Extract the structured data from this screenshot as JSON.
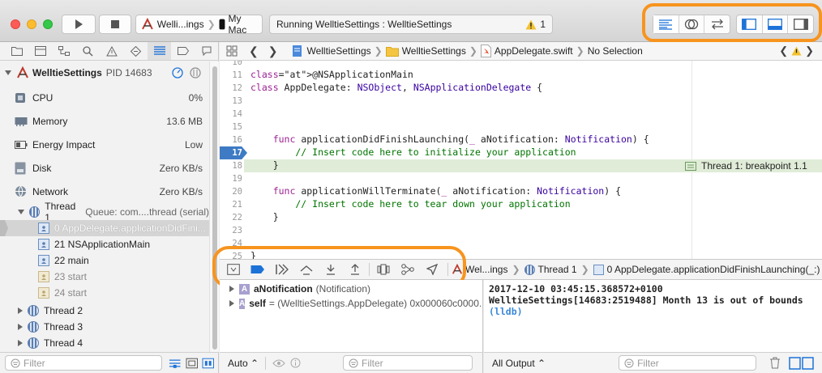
{
  "colors": {
    "accent": "#1d72d8",
    "highlight": "#f7941e",
    "breakpoint_line": "#e0ecd8",
    "breakpoint": "#3e7bc4"
  },
  "toolbar": {
    "scheme_target": "Welli...ings",
    "device": "My Mac",
    "status": "Running WelltieSettings : WelltieSettings",
    "warning_count": "1",
    "editor_icons": [
      "standard-editor-icon",
      "assistant-editor-icon",
      "version-editor-icon"
    ],
    "view_icons": [
      "navigator-toggle-icon",
      "debug-area-toggle-icon",
      "utilities-toggle-icon"
    ]
  },
  "navigator": {
    "process": {
      "name": "WelltieSettings",
      "pid": "PID 14683"
    },
    "gauges": [
      {
        "label": "CPU",
        "value": "0%",
        "icon": "cpu-icon"
      },
      {
        "label": "Memory",
        "value": "13.6 MB",
        "icon": "memory-icon"
      },
      {
        "label": "Energy Impact",
        "value": "Low",
        "icon": "energy-icon"
      },
      {
        "label": "Disk",
        "value": "Zero KB/s",
        "icon": "disk-icon"
      },
      {
        "label": "Network",
        "value": "Zero KB/s",
        "icon": "network-icon"
      }
    ],
    "thread1": {
      "name": "Thread 1",
      "queue": "Queue: com....thread (serial)"
    },
    "frames": [
      {
        "label": "0 AppDelegate.applicationDidFini...",
        "selected": true,
        "dim": false
      },
      {
        "label": "21 NSApplicationMain",
        "selected": false,
        "dim": false
      },
      {
        "label": "22 main",
        "selected": false,
        "dim": false
      },
      {
        "label": "23 start",
        "selected": false,
        "dim": true
      },
      {
        "label": "24 start",
        "selected": false,
        "dim": true
      }
    ],
    "threads": [
      "Thread 2",
      "Thread 3",
      "Thread 4"
    ],
    "filter_placeholder": "Filter"
  },
  "jumpbar": {
    "project": "WelltieSettings",
    "group": "WelltieSettings",
    "file": "AppDelegate.swift",
    "selection": "No Selection"
  },
  "editor": {
    "lines": [
      {
        "n": "10",
        "text": ""
      },
      {
        "n": "11",
        "text": "@NSApplicationMain"
      },
      {
        "n": "12",
        "text": "class AppDelegate: NSObject, NSApplicationDelegate {"
      },
      {
        "n": "13",
        "text": ""
      },
      {
        "n": "14",
        "text": ""
      },
      {
        "n": "15",
        "text": ""
      },
      {
        "n": "16",
        "text": "    func applicationDidFinishLaunching(_ aNotification: Notification) {"
      },
      {
        "n": "17",
        "text": "        // Insert code here to initialize your application"
      },
      {
        "n": "18",
        "text": "    }"
      },
      {
        "n": "19",
        "text": ""
      },
      {
        "n": "20",
        "text": "    func applicationWillTerminate(_ aNotification: Notification) {"
      },
      {
        "n": "21",
        "text": "        // Insert code here to tear down your application"
      },
      {
        "n": "22",
        "text": "    }"
      },
      {
        "n": "23",
        "text": ""
      },
      {
        "n": "24",
        "text": ""
      },
      {
        "n": "25",
        "text": "}"
      }
    ],
    "breakpoint_line": "17",
    "annotation": "Thread 1: breakpoint 1.1"
  },
  "debugbar": {
    "icons": [
      "hide-debug-area-icon",
      "breakpoints-toggle-icon",
      "continue-icon",
      "step-over-icon",
      "step-into-icon",
      "step-out-icon",
      "view-hierarchy-icon",
      "memory-graph-icon",
      "simulate-location-icon"
    ],
    "path_target": "Wel...ings",
    "path_thread": "Thread 1",
    "path_frame": "0 AppDelegate.applicationDidFinishLaunching(_:)"
  },
  "variables": [
    {
      "name": "aNotification",
      "value": "(Notification)"
    },
    {
      "name": "self",
      "value": "= (WelltieSettings.AppDelegate) 0x000060c0000..."
    }
  ],
  "variables_footer": {
    "scope": "Auto ⌃",
    "filter_placeholder": "Filter"
  },
  "console": {
    "lines": [
      "2017-12-10 03:45:15.368572+0100",
      "WelltieSettings[14683:2519488] Month 13 is out of bounds"
    ],
    "prompt": "(lldb)",
    "output_scope": "All Output ⌃",
    "filter_placeholder": "Filter"
  }
}
